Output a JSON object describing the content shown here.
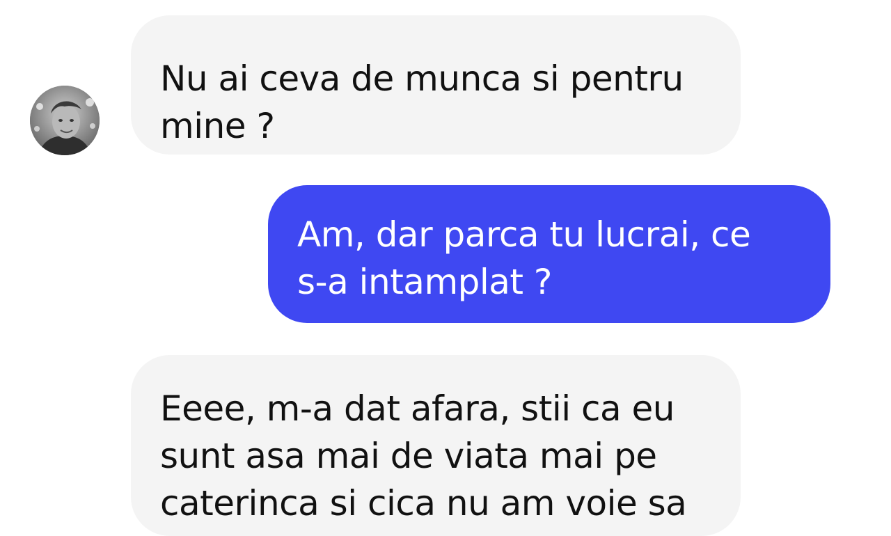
{
  "conversation": {
    "messages": [
      {
        "sender": "contact",
        "text": "Nu ai ceva de munca si pentru\nmine ?"
      },
      {
        "sender": "me",
        "text": "Am, dar parca tu lucrai, ce\ns-a intamplat ?"
      },
      {
        "sender": "contact",
        "text": "Eeee, m-a dat afara, stii ca eu\nsunt asa mai de viata mai pe\ncaterinca si cica nu am voie sa"
      }
    ]
  },
  "colors": {
    "incoming_bubble": "#f4f4f4",
    "outgoing_bubble": "#3f48f2",
    "incoming_text": "#111111",
    "outgoing_text": "#ffffff"
  }
}
